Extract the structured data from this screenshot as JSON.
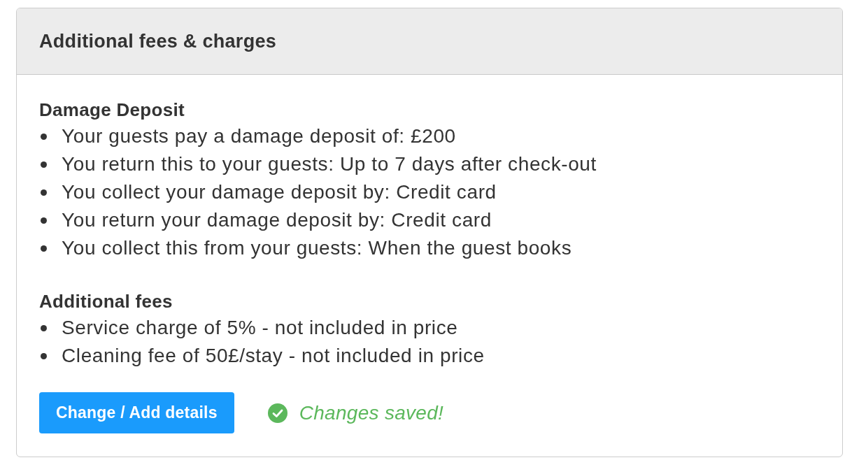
{
  "panel": {
    "title": "Additional fees & charges"
  },
  "sections": [
    {
      "heading": "Damage Deposit",
      "items": [
        "Your guests pay a damage deposit of: £200",
        "You return this to your guests: Up to 7 days after check-out",
        "You collect your damage deposit by: Credit card",
        "You return your damage deposit by: Credit card",
        "You collect this from your guests: When the guest books"
      ]
    },
    {
      "heading": "Additional fees",
      "items": [
        "Service charge of 5% - not included in price",
        "Cleaning fee of 50£/stay - not included in price"
      ]
    }
  ],
  "actions": {
    "button": "Change / Add details",
    "status": {
      "kind": "success",
      "text": "Changes saved!"
    }
  }
}
